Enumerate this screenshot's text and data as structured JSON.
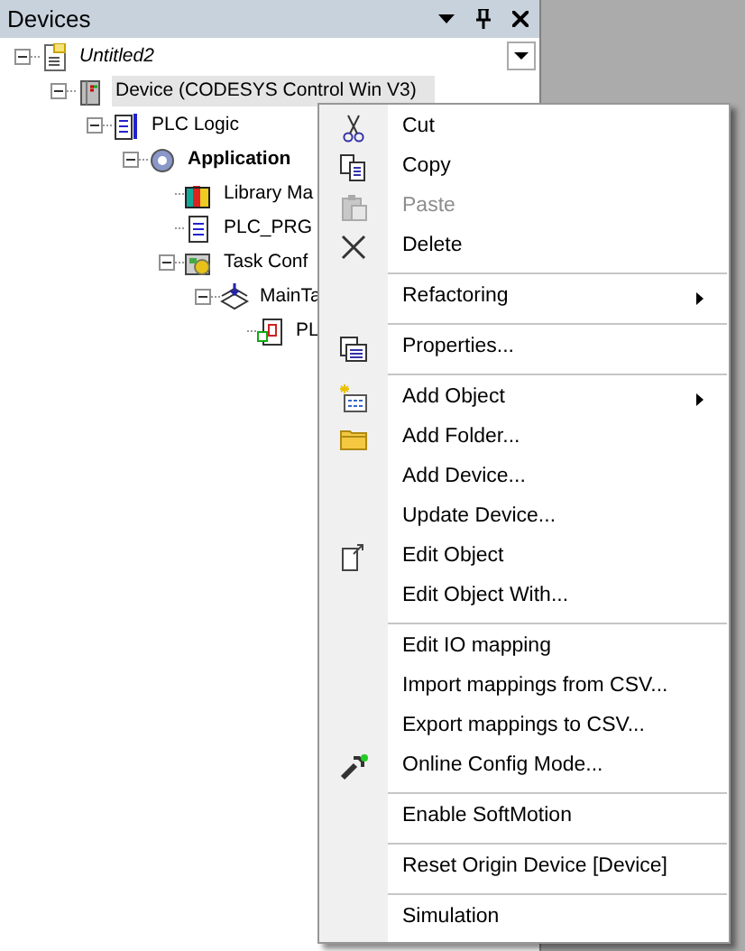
{
  "panel": {
    "title": "Devices"
  },
  "tree": [
    {
      "label": "Untitled2",
      "kind": "project",
      "expanded": true,
      "selected": false,
      "children": [
        {
          "label": "Device (CODESYS Control Win V3)",
          "kind": "device",
          "expanded": true,
          "selected": true,
          "children": [
            {
              "label": "PLC Logic",
              "kind": "plc-logic",
              "expanded": true,
              "selected": false,
              "children": [
                {
                  "label": "Application",
                  "kind": "application",
                  "expanded": true,
                  "selected": false,
                  "children": [
                    {
                      "label": "Library Ma",
                      "kind": "library",
                      "selected": false
                    },
                    {
                      "label": "PLC_PRG",
                      "kind": "pou",
                      "selected": false
                    },
                    {
                      "label": "Task Conf",
                      "kind": "task-config",
                      "expanded": true,
                      "selected": false,
                      "children": [
                        {
                          "label": "MainTa",
                          "kind": "task",
                          "expanded": true,
                          "selected": false,
                          "children": [
                            {
                              "label": "PL",
                              "kind": "call",
                              "selected": false
                            }
                          ]
                        }
                      ]
                    }
                  ]
                }
              ]
            }
          ]
        }
      ]
    }
  ],
  "context_menu": {
    "groups": [
      [
        {
          "label": "Cut",
          "disabled": false,
          "submenu": false
        },
        {
          "label": "Copy",
          "disabled": false,
          "submenu": false
        },
        {
          "label": "Paste",
          "disabled": true,
          "submenu": false
        },
        {
          "label": "Delete",
          "disabled": false,
          "submenu": false
        }
      ],
      [
        {
          "label": "Refactoring",
          "disabled": false,
          "submenu": true
        }
      ],
      [
        {
          "label": "Properties...",
          "disabled": false,
          "submenu": false
        }
      ],
      [
        {
          "label": "Add Object",
          "disabled": false,
          "submenu": true
        },
        {
          "label": "Add Folder...",
          "disabled": false,
          "submenu": false
        },
        {
          "label": "Add Device...",
          "disabled": false,
          "submenu": false
        },
        {
          "label": "Update Device...",
          "disabled": false,
          "submenu": false
        },
        {
          "label": "Edit Object",
          "disabled": false,
          "submenu": false
        },
        {
          "label": "Edit Object With...",
          "disabled": false,
          "submenu": false
        }
      ],
      [
        {
          "label": "Edit IO mapping",
          "disabled": false,
          "submenu": false
        },
        {
          "label": "Import mappings from CSV...",
          "disabled": false,
          "submenu": false
        },
        {
          "label": "Export mappings to CSV...",
          "disabled": false,
          "submenu": false
        },
        {
          "label": "Online Config Mode...",
          "disabled": false,
          "submenu": false
        }
      ],
      [
        {
          "label": "Enable SoftMotion",
          "disabled": false,
          "submenu": false
        }
      ],
      [
        {
          "label": "Reset Origin Device [Device]",
          "disabled": false,
          "submenu": false
        }
      ],
      [
        {
          "label": "Simulation",
          "disabled": false,
          "submenu": false
        }
      ]
    ]
  }
}
